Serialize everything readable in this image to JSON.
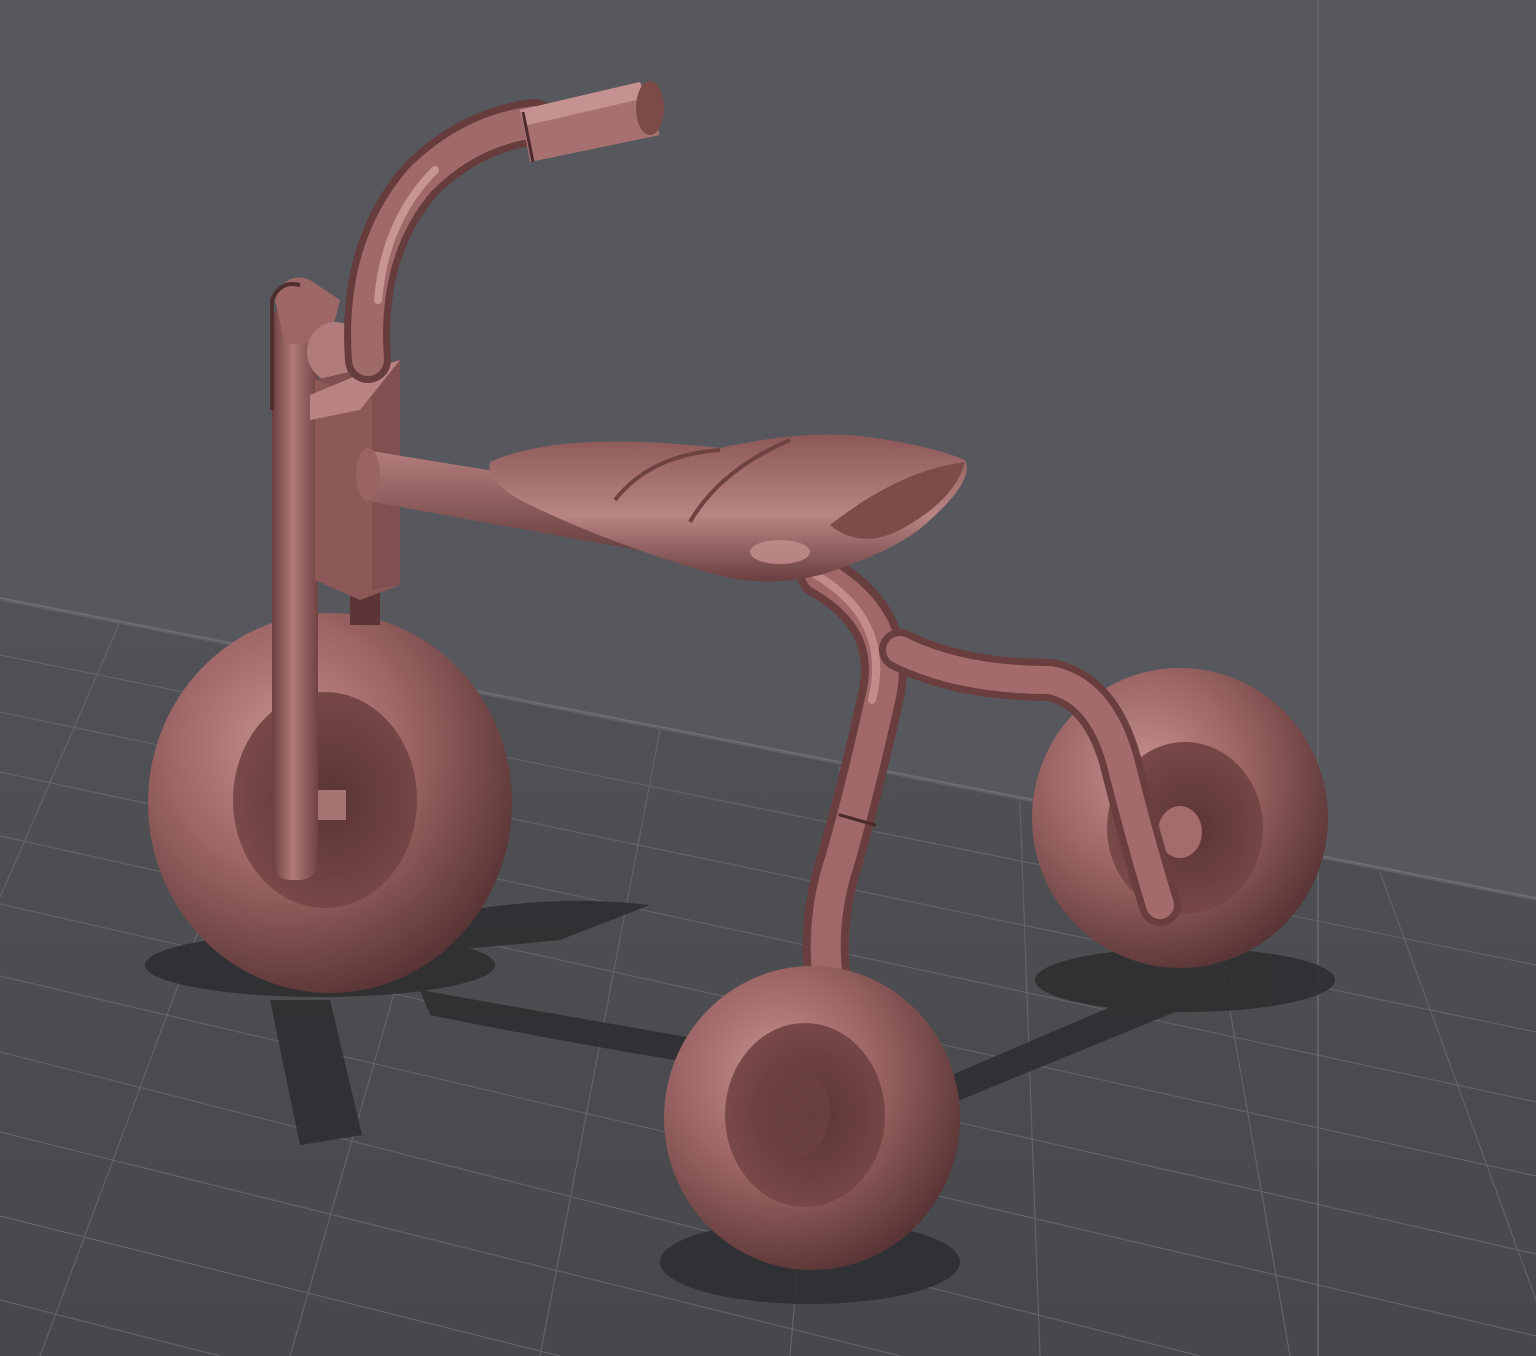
{
  "viewport": {
    "label": "",
    "background_color": "#55575c",
    "floor_color": "#4b4c50",
    "grid_line_color": "#63656a",
    "model": {
      "name": "",
      "object": "tricycle",
      "material_color": "#a26a6a",
      "material_highlight": "#c99494",
      "material_shadow": "#5a3535",
      "parts": [
        "handlebar",
        "handle-grip",
        "fork",
        "head-tube",
        "top-tube",
        "seat",
        "rear-frame",
        "front-wheel",
        "rear-left-wheel",
        "rear-right-wheel"
      ]
    },
    "shadow_color": "#2c2c2f"
  }
}
